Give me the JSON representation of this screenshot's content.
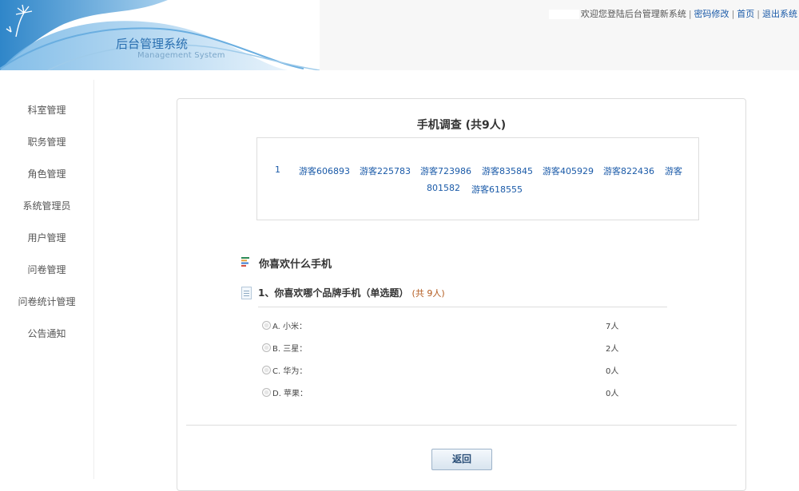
{
  "header": {
    "app_title": "后台管理系统",
    "app_subtitle": "Management System",
    "welcome": "欢迎您登陆后台管理新系统",
    "links": [
      "密码修改",
      "首页",
      "退出系统"
    ]
  },
  "sidebar": {
    "items": [
      {
        "label": "科室管理"
      },
      {
        "label": "职务管理"
      },
      {
        "label": "角色管理"
      },
      {
        "label": "系统管理员"
      },
      {
        "label": "用户管理"
      },
      {
        "label": "问卷管理"
      },
      {
        "label": "问卷统计管理"
      },
      {
        "label": "公告通知"
      }
    ]
  },
  "survey": {
    "title": "手机调查 (共9人)",
    "participant_row_index": "1",
    "participants": [
      "游客606893",
      "游客225783",
      "游客723986",
      "游客835845",
      "游客405929",
      "游客822436",
      "游客",
      "801582",
      "游客618555"
    ],
    "section_title": "你喜欢什么手机",
    "question": {
      "title": "1、你喜欢哪个品牌手机（单选题）",
      "count": "(共 9人)",
      "options": [
        {
          "label": "A. 小米：",
          "count": "7人"
        },
        {
          "label": "B. 三星：",
          "count": "2人"
        },
        {
          "label": "C. 华为：",
          "count": "0人"
        },
        {
          "label": "D. 苹果：",
          "count": "0人"
        }
      ]
    },
    "back_label": "返回"
  },
  "colors": {
    "link": "#1a5aa8",
    "brand_blue": "#2a6fb0",
    "count_orange": "#b35b1f"
  }
}
